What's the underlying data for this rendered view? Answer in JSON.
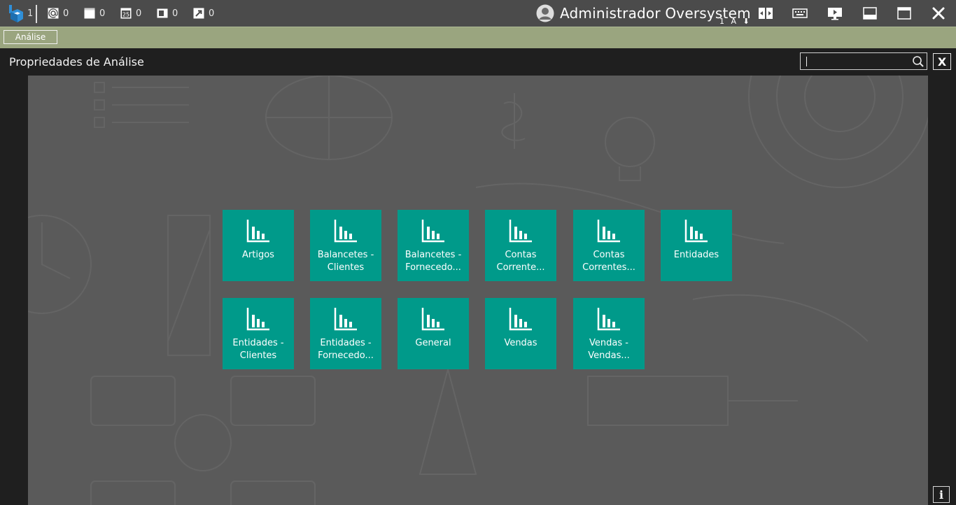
{
  "topbar": {
    "app_count": "1",
    "counters": [
      {
        "icon": "at-sign-icon",
        "value": "0"
      },
      {
        "icon": "document-icon",
        "value": "0"
      },
      {
        "icon": "calendar-icon",
        "value": "0"
      },
      {
        "icon": "window-icon",
        "value": "0"
      },
      {
        "icon": "external-link-icon",
        "value": "0"
      }
    ],
    "calendar_day": "25",
    "user_name": "Administrador Oversystem",
    "user_sub": "1 A ⬇"
  },
  "tabs": [
    {
      "label": "Análise"
    }
  ],
  "panel": {
    "title": "Propriedades de Análise",
    "search_value": "",
    "close_label": "X",
    "info_label": "i"
  },
  "tiles": [
    {
      "label": "Artigos"
    },
    {
      "label": "Balancetes -\nClientes"
    },
    {
      "label": "Balancetes -\nFornecedo..."
    },
    {
      "label": "Contas\nCorrente..."
    },
    {
      "label": "Contas\nCorrentes..."
    },
    {
      "label": "Entidades"
    },
    {
      "label": "Entidades -\nClientes"
    },
    {
      "label": "Entidades -\nFornecedo..."
    },
    {
      "label": "General"
    },
    {
      "label": "Vendas"
    },
    {
      "label": "Vendas -\nVendas..."
    }
  ],
  "colors": {
    "topbar": "#4b4b4b",
    "strip": "#9aa57f",
    "tile": "#009a8a",
    "main": "#5a5a5a",
    "frame": "#1f1f1f"
  }
}
